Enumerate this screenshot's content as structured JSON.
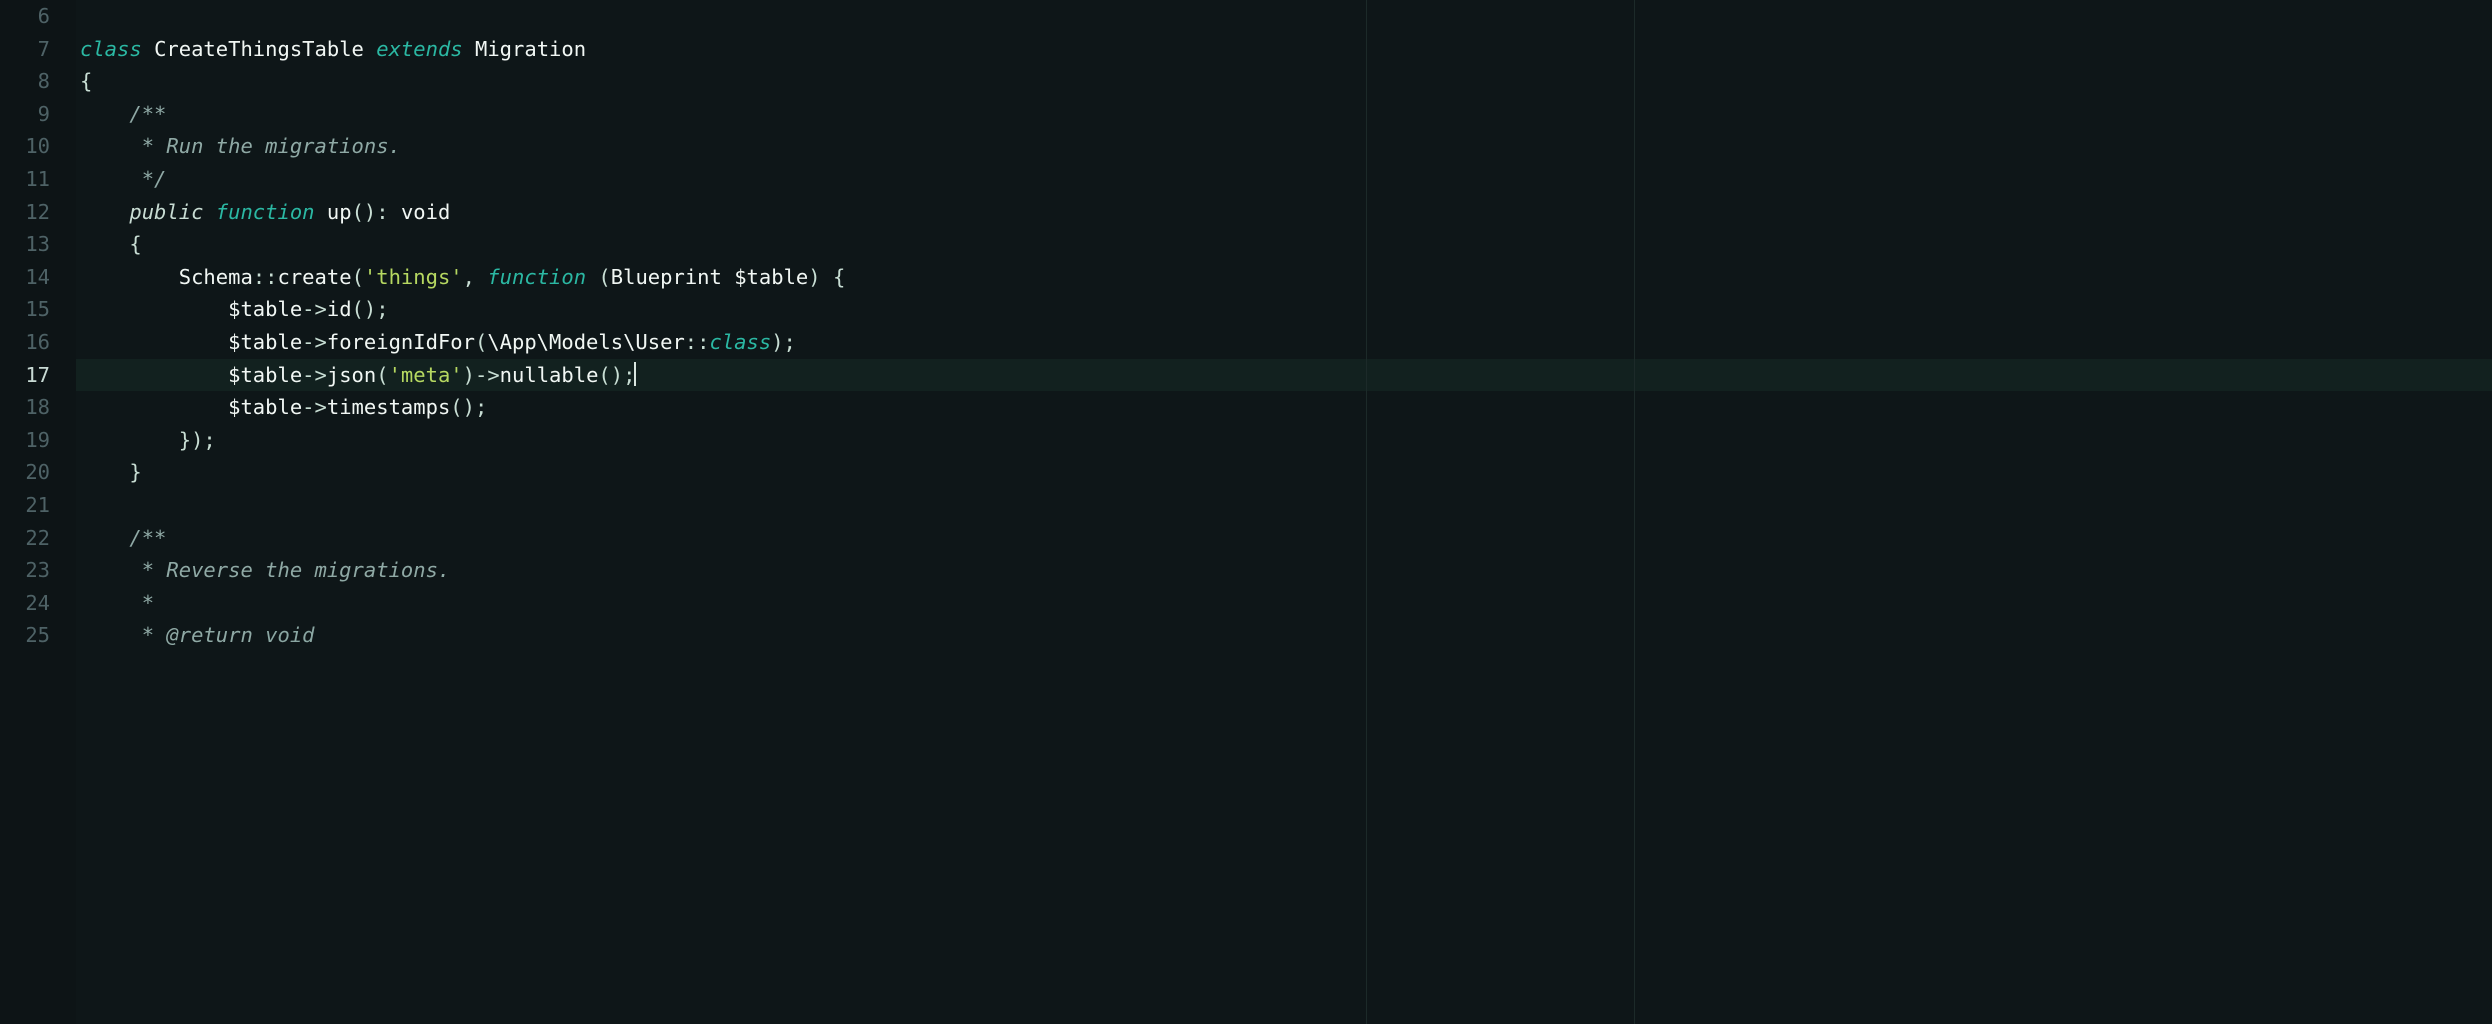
{
  "editor": {
    "active_line": 17,
    "ruler_columns": [
      1290,
      1558
    ],
    "gutter_start": 6,
    "gutter_end": 25,
    "lines": [
      {
        "num": 6,
        "segments": [
          {
            "t": "",
            "c": ""
          }
        ]
      },
      {
        "num": 7,
        "segments": [
          {
            "t": "class",
            "c": "tok-kw"
          },
          {
            "t": " ",
            "c": ""
          },
          {
            "t": "CreateThingsTable",
            "c": "tok-name"
          },
          {
            "t": " ",
            "c": ""
          },
          {
            "t": "extends",
            "c": "tok-kw"
          },
          {
            "t": " ",
            "c": ""
          },
          {
            "t": "Migration",
            "c": "tok-type"
          }
        ]
      },
      {
        "num": 8,
        "segments": [
          {
            "t": "{",
            "c": "tok-punc"
          }
        ]
      },
      {
        "num": 9,
        "segments": [
          {
            "t": "    /**",
            "c": "tok-com"
          }
        ]
      },
      {
        "num": 10,
        "segments": [
          {
            "t": "     * Run the migrations.",
            "c": "tok-com"
          }
        ]
      },
      {
        "num": 11,
        "segments": [
          {
            "t": "     */",
            "c": "tok-com"
          }
        ]
      },
      {
        "num": 12,
        "segments": [
          {
            "t": "    ",
            "c": ""
          },
          {
            "t": "public",
            "c": "tok-mod"
          },
          {
            "t": " ",
            "c": ""
          },
          {
            "t": "function",
            "c": "tok-kw"
          },
          {
            "t": " ",
            "c": ""
          },
          {
            "t": "up",
            "c": "tok-name"
          },
          {
            "t": "(): ",
            "c": "tok-punc"
          },
          {
            "t": "void",
            "c": "tok-name"
          }
        ]
      },
      {
        "num": 13,
        "segments": [
          {
            "t": "    {",
            "c": "tok-punc"
          }
        ]
      },
      {
        "num": 14,
        "segments": [
          {
            "t": "        ",
            "c": ""
          },
          {
            "t": "Schema",
            "c": "tok-name"
          },
          {
            "t": "::",
            "c": "tok-punc"
          },
          {
            "t": "create",
            "c": "tok-name"
          },
          {
            "t": "(",
            "c": "tok-punc"
          },
          {
            "t": "'things'",
            "c": "tok-str"
          },
          {
            "t": ", ",
            "c": "tok-punc"
          },
          {
            "t": "function",
            "c": "tok-kw"
          },
          {
            "t": " (",
            "c": "tok-punc"
          },
          {
            "t": "Blueprint",
            "c": "tok-type"
          },
          {
            "t": " ",
            "c": ""
          },
          {
            "t": "$table",
            "c": "tok-name"
          },
          {
            "t": ") {",
            "c": "tok-punc"
          }
        ]
      },
      {
        "num": 15,
        "segments": [
          {
            "t": "            ",
            "c": ""
          },
          {
            "t": "$table",
            "c": "tok-name"
          },
          {
            "t": "->",
            "c": "tok-punc"
          },
          {
            "t": "id",
            "c": "tok-name"
          },
          {
            "t": "();",
            "c": "tok-punc"
          }
        ]
      },
      {
        "num": 16,
        "segments": [
          {
            "t": "            ",
            "c": ""
          },
          {
            "t": "$table",
            "c": "tok-name"
          },
          {
            "t": "->",
            "c": "tok-punc"
          },
          {
            "t": "foreignIdFor",
            "c": "tok-name"
          },
          {
            "t": "(",
            "c": "tok-punc"
          },
          {
            "t": "\\App\\Models\\User",
            "c": "tok-name"
          },
          {
            "t": "::",
            "c": "tok-punc"
          },
          {
            "t": "class",
            "c": "tok-class"
          },
          {
            "t": ");",
            "c": "tok-punc"
          }
        ]
      },
      {
        "num": 17,
        "active": true,
        "cursor": true,
        "segments": [
          {
            "t": "            ",
            "c": ""
          },
          {
            "t": "$table",
            "c": "tok-name"
          },
          {
            "t": "->",
            "c": "tok-punc"
          },
          {
            "t": "json",
            "c": "tok-name"
          },
          {
            "t": "(",
            "c": "tok-punc"
          },
          {
            "t": "'meta'",
            "c": "tok-str"
          },
          {
            "t": ")->",
            "c": "tok-punc"
          },
          {
            "t": "nullable",
            "c": "tok-name"
          },
          {
            "t": "();",
            "c": "tok-punc"
          }
        ]
      },
      {
        "num": 18,
        "segments": [
          {
            "t": "            ",
            "c": ""
          },
          {
            "t": "$table",
            "c": "tok-name"
          },
          {
            "t": "->",
            "c": "tok-punc"
          },
          {
            "t": "timestamps",
            "c": "tok-name"
          },
          {
            "t": "();",
            "c": "tok-punc"
          }
        ]
      },
      {
        "num": 19,
        "segments": [
          {
            "t": "        });",
            "c": "tok-punc"
          }
        ]
      },
      {
        "num": 20,
        "segments": [
          {
            "t": "    }",
            "c": "tok-punc"
          }
        ]
      },
      {
        "num": 21,
        "segments": [
          {
            "t": "",
            "c": ""
          }
        ]
      },
      {
        "num": 22,
        "segments": [
          {
            "t": "    /**",
            "c": "tok-com"
          }
        ]
      },
      {
        "num": 23,
        "segments": [
          {
            "t": "     * Reverse the migrations.",
            "c": "tok-com"
          }
        ]
      },
      {
        "num": 24,
        "segments": [
          {
            "t": "     *",
            "c": "tok-com"
          }
        ]
      },
      {
        "num": 25,
        "segments": [
          {
            "t": "     * ",
            "c": "tok-com"
          },
          {
            "t": "@return",
            "c": "tok-ctag"
          },
          {
            "t": " ",
            "c": "tok-com"
          },
          {
            "t": "void",
            "c": "tok-void"
          }
        ]
      }
    ]
  }
}
